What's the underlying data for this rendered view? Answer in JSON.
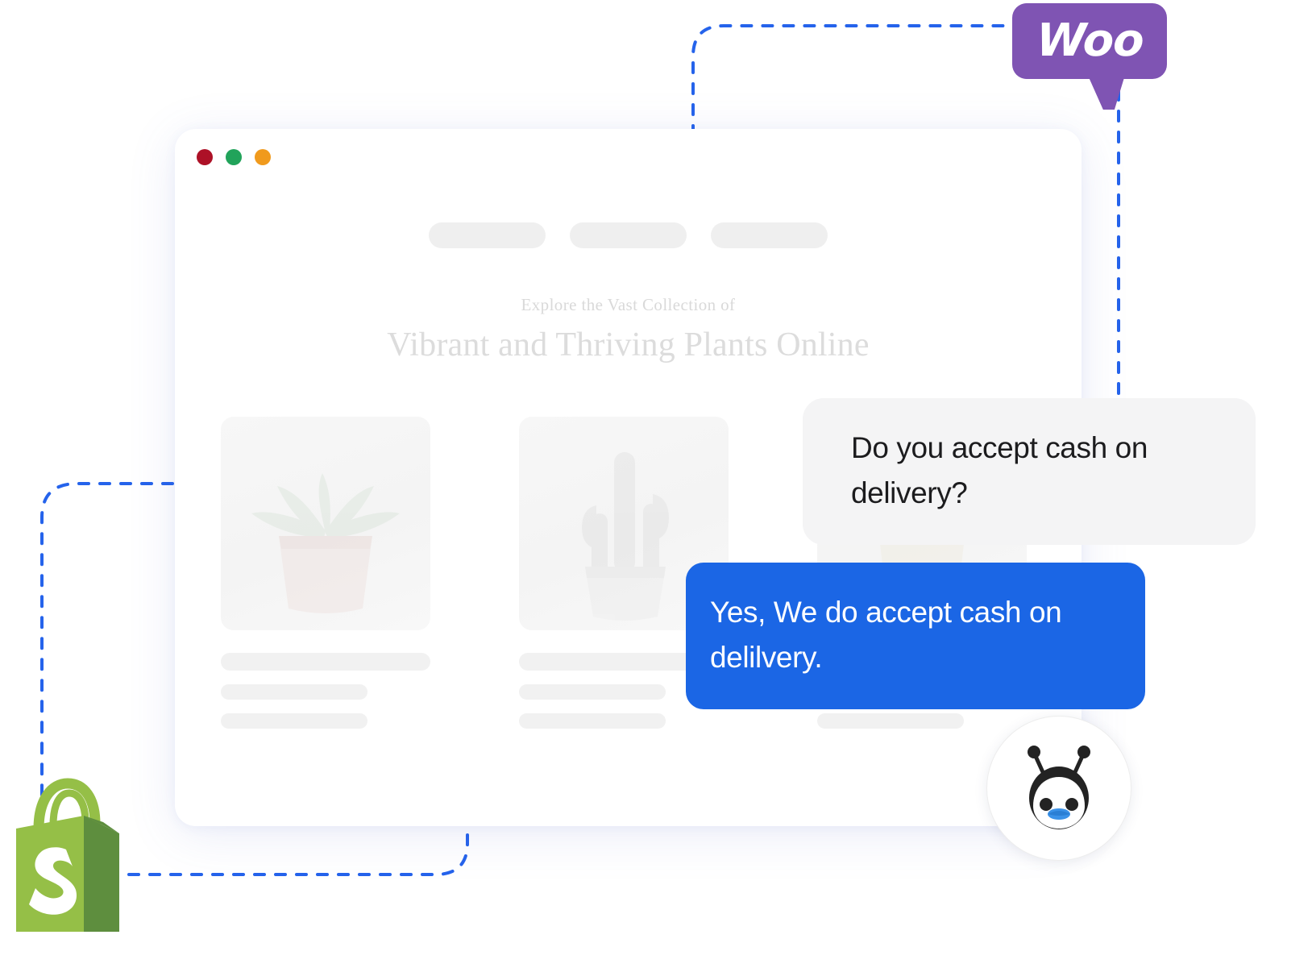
{
  "window": {
    "traffic_lights": [
      {
        "name": "close",
        "color": "#AD1127"
      },
      {
        "name": "minimize",
        "color": "#21A35A"
      },
      {
        "name": "maximize",
        "color": "#F09A1D"
      }
    ],
    "nav_placeholders": [
      "",
      "",
      ""
    ]
  },
  "hero": {
    "eyebrow": "Explore the Vast Collection of",
    "title": "Vibrant and Thriving Plants Online"
  },
  "products": [
    {
      "name": "succulent-in-pink-pot",
      "title_skeleton": "",
      "line1_skeleton": "",
      "line2_skeleton": ""
    },
    {
      "name": "cactus-in-grey-pot",
      "title_skeleton": "",
      "line1_skeleton": "",
      "line2_skeleton": ""
    },
    {
      "name": "leafy-plant",
      "title_skeleton": "",
      "line1_skeleton": "",
      "line2_skeleton": ""
    }
  ],
  "platforms": {
    "woo": {
      "wordmark": "Woo",
      "bubble_color": "#7F54B3",
      "text_color": "#FFFFFF"
    },
    "shopify": {
      "name": "shopify-bag-logo",
      "front_color": "#95BF47",
      "side_color": "#5E8E3E",
      "letter_color": "#FFFFFF"
    }
  },
  "connectors": {
    "color": "#2563EB",
    "style": "dashed"
  },
  "chat": {
    "messages": [
      {
        "role": "customer",
        "text": "Do you accept cash on delivery?",
        "bubble_color": "#F4F4F5",
        "text_color": "#1C1C1E"
      },
      {
        "role": "bot",
        "text": "Yes, We do accept cash on delilvery.",
        "bubble_color": "#1B66E5",
        "text_color": "#FFFFFF"
      }
    ],
    "avatar": {
      "name": "penguin-bot-avatar",
      "body_color": "#232323",
      "beak_color": "#3B92E8"
    }
  }
}
